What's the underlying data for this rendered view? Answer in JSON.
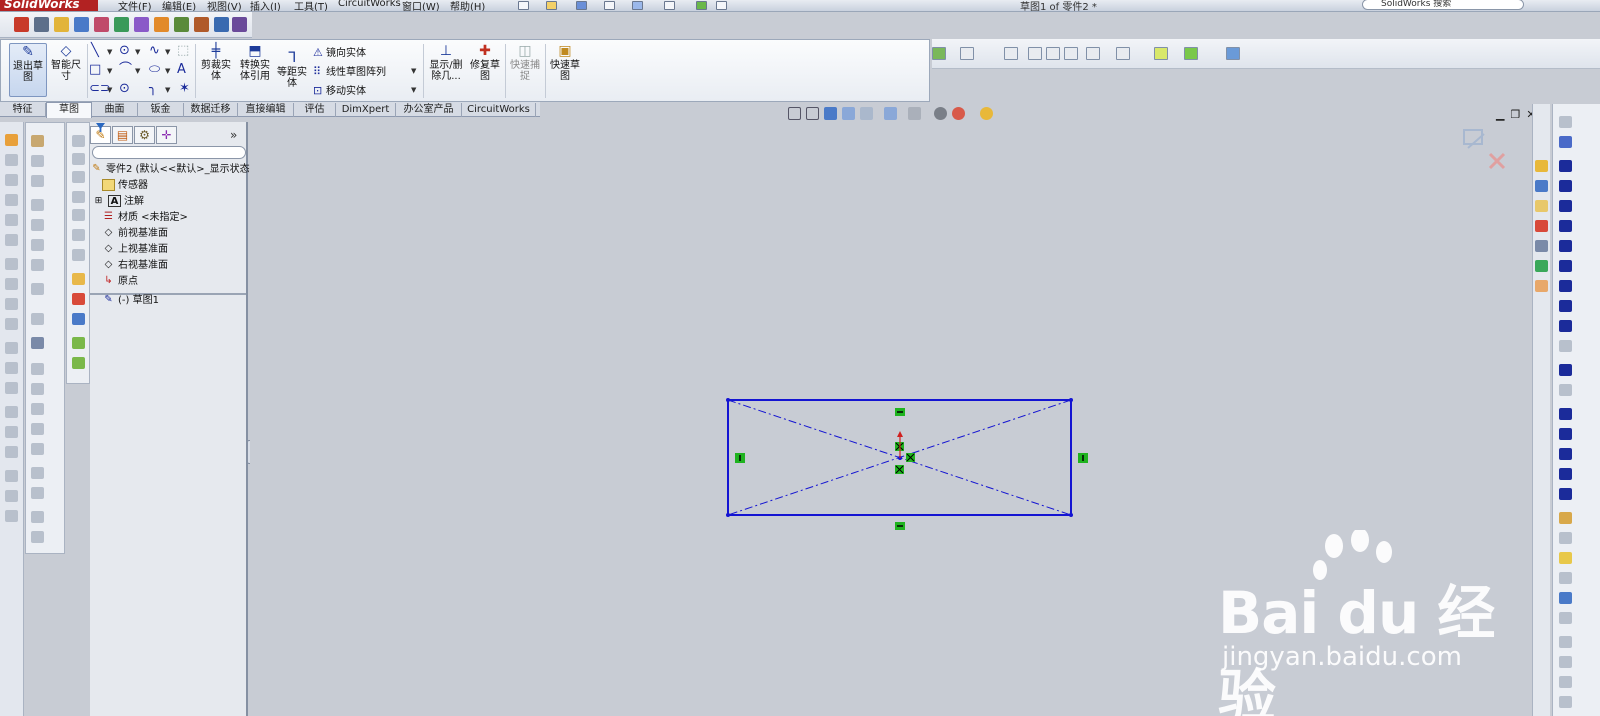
{
  "app": {
    "logo": "SolidWorks",
    "title": "草图1 of 零件2 *"
  },
  "menu": [
    "文件(F)",
    "编辑(E)",
    "视图(V)",
    "插入(I)",
    "工具(T)",
    "CircuitWorks",
    "窗口(W)",
    "帮助(H)"
  ],
  "search": {
    "placeholder": "SolidWorks 搜索"
  },
  "command_manager": {
    "exit_sketch": "退出草图",
    "smart_dimension": "智能尺寸",
    "trim": "剪裁实体",
    "convert": "转换实体引用",
    "offset": "等距实体",
    "mirror": "镜向实体",
    "linear_pattern": "线性草图阵列",
    "move": "移动实体",
    "display_delete": "显示/删除几...",
    "repair": "修复草图",
    "quick_snaps": "快速捕捉",
    "rapid_sketch": "快速草图"
  },
  "tabs": [
    {
      "label": "特征",
      "active": false
    },
    {
      "label": "草图",
      "active": true
    },
    {
      "label": "曲面",
      "active": false
    },
    {
      "label": "钣金",
      "active": false
    },
    {
      "label": "数据迁移",
      "active": false
    },
    {
      "label": "直接编辑",
      "active": false
    },
    {
      "label": "评估",
      "active": false
    },
    {
      "label": "DimXpert",
      "active": false
    },
    {
      "label": "办公室产品",
      "active": false
    },
    {
      "label": "CircuitWorks",
      "active": false
    }
  ],
  "feature_tree": {
    "root": "零件2 (默认<<默认>_显示状态",
    "items": [
      "传感器",
      "注解",
      "材质 <未指定>",
      "前视基准面",
      "上视基准面",
      "右视基准面",
      "原点"
    ],
    "sketch": "(-) 草图1"
  },
  "watermark": {
    "brand": "Bai du 经验",
    "url": "jingyan.baidu.com"
  },
  "colors": {
    "sketch_line": "#1414d2",
    "relation_marker": "#1fb31f",
    "accent": "#b22222"
  }
}
